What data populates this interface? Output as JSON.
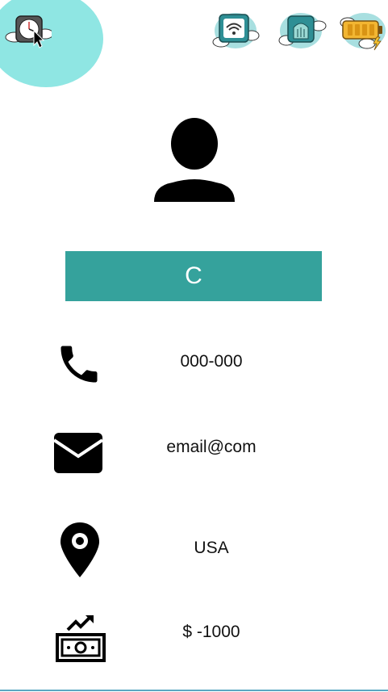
{
  "status_bar": {
    "icons": [
      "clock-icon",
      "wifi-icon",
      "home-icon",
      "battery-icon"
    ],
    "accent_color": "#8fe6e3"
  },
  "profile": {
    "avatar_icon": "user-avatar-icon",
    "name": "C",
    "banner_color": "#35a29c"
  },
  "details": {
    "phone": "000-000",
    "email": "email@com",
    "location": "USA",
    "balance": "$ -1000"
  }
}
